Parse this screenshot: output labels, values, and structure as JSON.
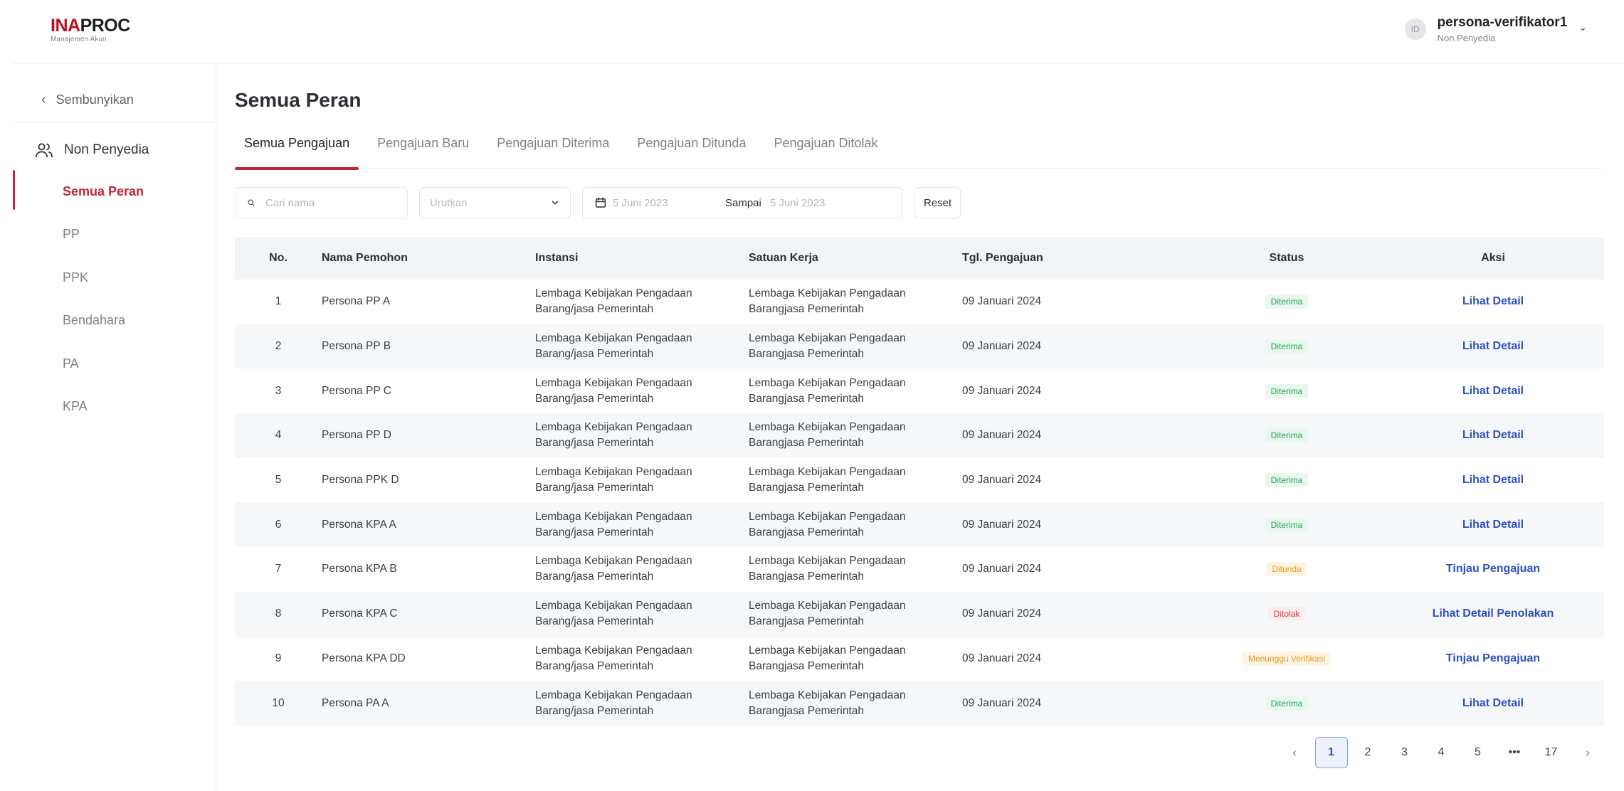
{
  "header": {
    "logo_ina": "INA",
    "logo_proc": "PROC",
    "logo_sub": "Manajemen Akun",
    "avatar_initials": "ID",
    "user_name": "persona-verifikator1",
    "user_role": "Non Penyedia"
  },
  "sidebar": {
    "hide_label": "Sembunyikan",
    "group_title": "Non Penyedia",
    "items": [
      {
        "label": "Semua Peran",
        "active": true
      },
      {
        "label": "PP"
      },
      {
        "label": "PPK"
      },
      {
        "label": "Bendahara"
      },
      {
        "label": "PA"
      },
      {
        "label": "KPA"
      }
    ]
  },
  "main": {
    "title": "Semua Peran",
    "tabs": [
      {
        "label": "Semua Pengajuan",
        "active": true
      },
      {
        "label": "Pengajuan Baru"
      },
      {
        "label": "Pengajuan Diterima"
      },
      {
        "label": "Pengajuan Ditunda"
      },
      {
        "label": "Pengajuan Ditolak"
      }
    ],
    "filters": {
      "search_placeholder": "Cari nama",
      "sort_placeholder": "Urutkan",
      "date_from": "5 Juni 2023",
      "date_sep": "Sampai",
      "date_to": "5 Juni 2023",
      "reset_label": "Reset"
    },
    "table": {
      "headers": [
        "No.",
        "Nama Pemohon",
        "Instansi",
        "Satuan Kerja",
        "Tgl. Pengajuan",
        "Status",
        "Aksi"
      ],
      "rows": [
        {
          "no": "1",
          "nama": "Persona PP A",
          "instansi_1": "Lembaga Kebijakan Pengadaan",
          "instansi_2": "Barang/jasa Pemerintah",
          "satker_1": "Lembaga Kebijakan Pengadaan",
          "satker_2": "Barangjasa Pemerintah",
          "tgl": "09 Januari 2024",
          "status": "Diterima",
          "aksi": "Lihat Detail"
        },
        {
          "no": "2",
          "nama": "Persona PP B",
          "instansi_1": "Lembaga Kebijakan Pengadaan",
          "instansi_2": "Barang/jasa Pemerintah",
          "satker_1": "Lembaga Kebijakan Pengadaan",
          "satker_2": "Barangjasa Pemerintah",
          "tgl": "09 Januari 2024",
          "status": "Diterima",
          "aksi": "Lihat Detail"
        },
        {
          "no": "3",
          "nama": "Persona PP C",
          "instansi_1": "Lembaga Kebijakan Pengadaan",
          "instansi_2": "Barang/jasa Pemerintah",
          "satker_1": "Lembaga Kebijakan Pengadaan",
          "satker_2": "Barangjasa Pemerintah",
          "tgl": "09 Januari 2024",
          "status": "Diterima",
          "aksi": "Lihat Detail"
        },
        {
          "no": "4",
          "nama": "Persona PP D",
          "instansi_1": "Lembaga Kebijakan Pengadaan",
          "instansi_2": "Barang/jasa Pemerintah",
          "satker_1": "Lembaga Kebijakan Pengadaan",
          "satker_2": "Barangjasa Pemerintah",
          "tgl": "09 Januari 2024",
          "status": "Diterima",
          "aksi": "Lihat Detail"
        },
        {
          "no": "5",
          "nama": "Persona PPK D",
          "instansi_1": "Lembaga Kebijakan Pengadaan",
          "instansi_2": "Barang/jasa Pemerintah",
          "satker_1": "Lembaga Kebijakan Pengadaan",
          "satker_2": "Barangjasa Pemerintah",
          "tgl": "09 Januari 2024",
          "status": "Diterima",
          "aksi": "Lihat Detail"
        },
        {
          "no": "6",
          "nama": "Persona KPA A",
          "instansi_1": "Lembaga Kebijakan Pengadaan",
          "instansi_2": "Barang/jasa Pemerintah",
          "satker_1": "Lembaga Kebijakan Pengadaan",
          "satker_2": "Barangjasa Pemerintah",
          "tgl": "09 Januari 2024",
          "status": "Diterima",
          "aksi": "Lihat Detail"
        },
        {
          "no": "7",
          "nama": "Persona KPA B",
          "instansi_1": "Lembaga Kebijakan Pengadaan",
          "instansi_2": "Barang/jasa Pemerintah",
          "satker_1": "Lembaga Kebijakan Pengadaan",
          "satker_2": "Barangjasa Pemerintah",
          "tgl": "09 Januari 2024",
          "status": "Ditunda",
          "aksi": "Tinjau Pengajuan"
        },
        {
          "no": "8",
          "nama": "Persona KPA C",
          "instansi_1": "Lembaga Kebijakan Pengadaan",
          "instansi_2": "Barang/jasa Pemerintah",
          "satker_1": "Lembaga Kebijakan Pengadaan",
          "satker_2": "Barangjasa Pemerintah",
          "tgl": "09 Januari 2024",
          "status": "Ditolak",
          "aksi": "Lihat Detail Penolakan"
        },
        {
          "no": "9",
          "nama": "Persona KPA DD",
          "instansi_1": "Lembaga Kebijakan Pengadaan",
          "instansi_2": "Barang/jasa Pemerintah",
          "satker_1": "Lembaga Kebijakan Pengadaan",
          "satker_2": "Barangjasa Pemerintah",
          "tgl": "09 Januari 2024",
          "status": "Menunggu Verifikasi",
          "aksi": "Tinjau Pengajuan"
        },
        {
          "no": "10",
          "nama": "Persona PA A",
          "instansi_1": "Lembaga Kebijakan Pengadaan",
          "instansi_2": "Barang/jasa Pemerintah",
          "satker_1": "Lembaga Kebijakan Pengadaan",
          "satker_2": "Barangjasa Pemerintah",
          "tgl": "09 Januari 2024",
          "status": "Diterima",
          "aksi": "Lihat Detail"
        }
      ]
    },
    "pagination": {
      "pages": [
        "1",
        "2",
        "3",
        "4",
        "5",
        "•••",
        "17"
      ],
      "current": "1",
      "prev_icon": "chevron-left-icon",
      "next_icon": "chevron-right-icon"
    }
  },
  "colors": {
    "brand_red": "#c0273a",
    "link_blue": "#2e4fbf",
    "status_green": "#23a455",
    "status_orange": "#e69a1a",
    "status_red": "#d83b3b"
  }
}
